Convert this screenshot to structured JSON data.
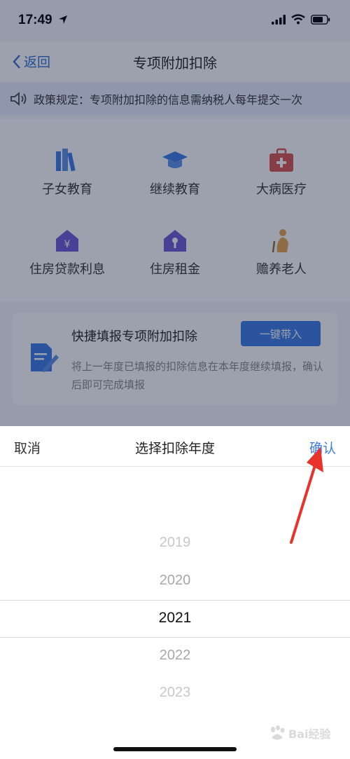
{
  "status_bar": {
    "time": "17:49",
    "icons": [
      "location-arrow-icon",
      "signal-icon",
      "wifi-icon",
      "battery-icon"
    ]
  },
  "nav": {
    "back_label": "返回",
    "title": "专项附加扣除"
  },
  "notice": {
    "text": "政策规定：专项附加扣除的信息需纳税人每年提交一次"
  },
  "categories": [
    {
      "label": "子女教育",
      "icon": "books-icon"
    },
    {
      "label": "继续教育",
      "icon": "graduation-cap-icon"
    },
    {
      "label": "大病医疗",
      "icon": "medical-kit-icon"
    },
    {
      "label": "住房贷款利息",
      "icon": "house-yuan-icon"
    },
    {
      "label": "住房租金",
      "icon": "house-key-icon"
    },
    {
      "label": "赡养老人",
      "icon": "elderly-icon"
    }
  ],
  "quick_fill": {
    "title": "快捷填报专项附加扣除",
    "button_label": "一键带入",
    "description": "将上一年度已填报的扣除信息在本年度继续填报，确认后即可完成填报",
    "icon": "document-edit-icon"
  },
  "picker": {
    "cancel_label": "取消",
    "title": "选择扣除年度",
    "confirm_label": "确认",
    "options": [
      "2019",
      "2020",
      "2021",
      "2022",
      "2023"
    ],
    "selected": "2021"
  },
  "watermark": {
    "text": "Bai经验"
  },
  "colors": {
    "accent": "#3d7be6",
    "arrow": "#e8332a",
    "overlay": "#141e3c"
  }
}
